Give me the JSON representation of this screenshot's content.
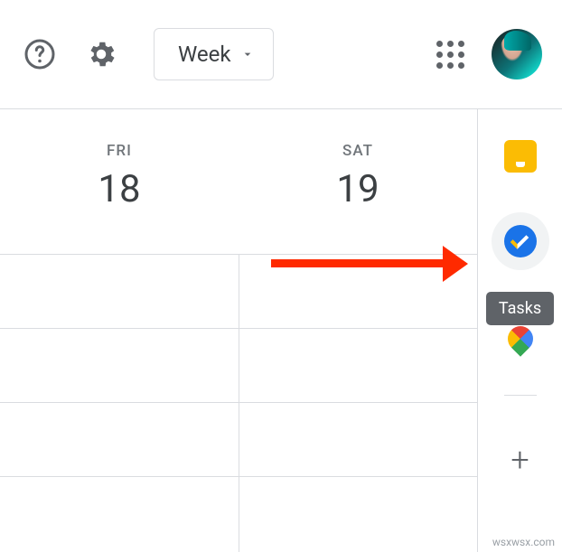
{
  "header": {
    "view_label": "Week"
  },
  "days": [
    {
      "name": "FRI",
      "num": "18"
    },
    {
      "name": "SAT",
      "num": "19"
    }
  ],
  "side_panel": {
    "tooltip": "Tasks",
    "add_label": "+"
  },
  "watermark": "wsxwsx.com"
}
